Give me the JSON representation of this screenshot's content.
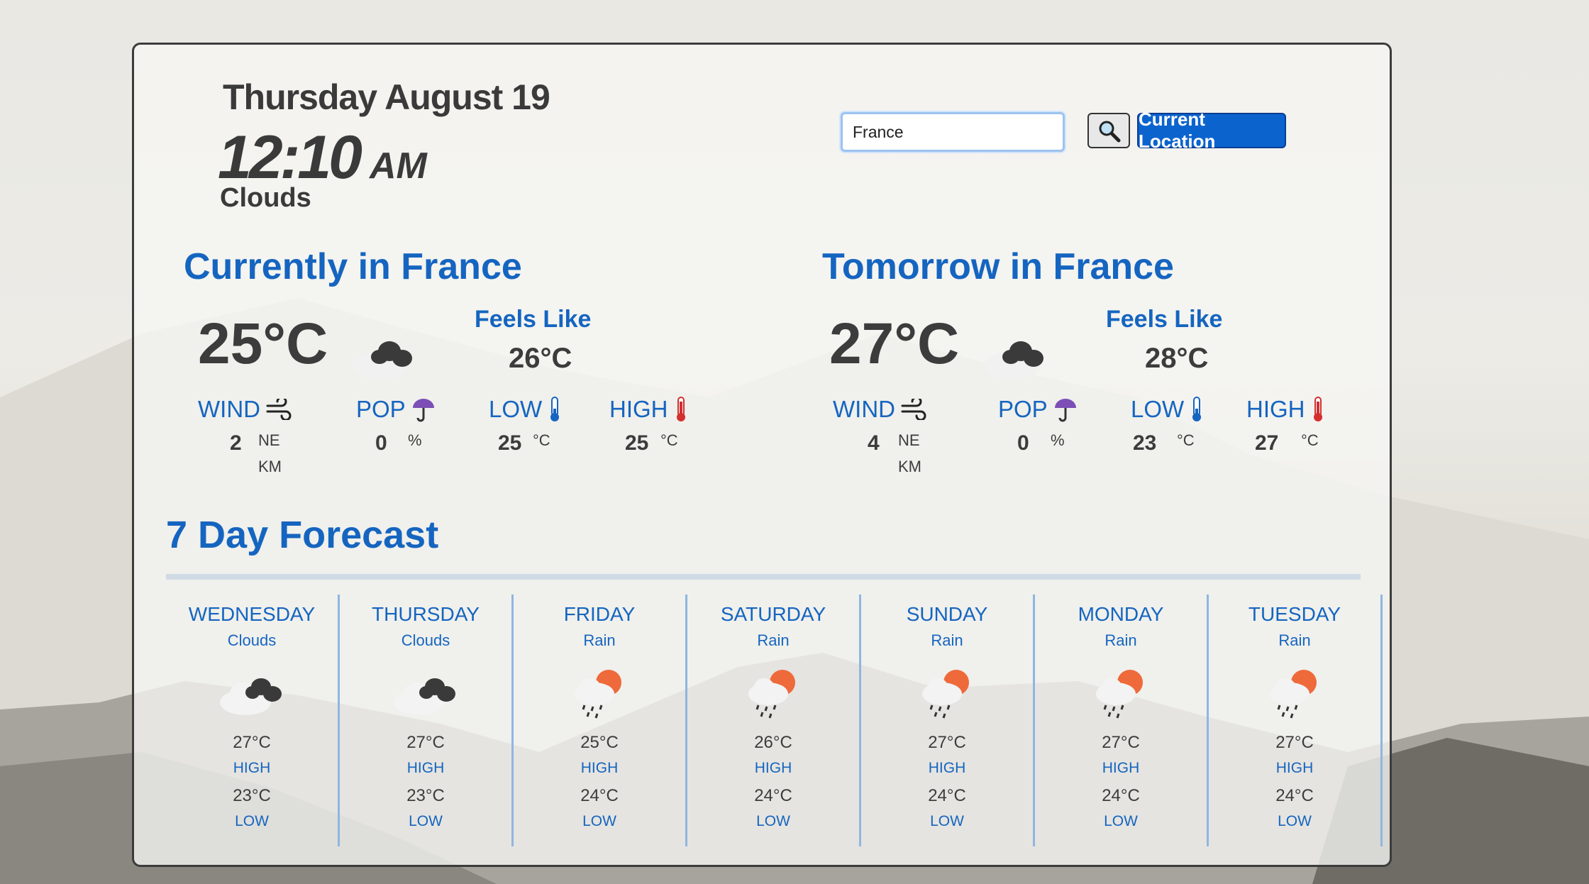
{
  "header": {
    "date": "Thursday August 19",
    "time": "12:10",
    "ampm": "AM",
    "condition": "Clouds"
  },
  "search": {
    "value": "France",
    "search_icon": "magnifier-icon",
    "location_button": "Current Location"
  },
  "current": {
    "heading": "Currently in France",
    "temp": "25°C",
    "icon": "dark-clouds-icon",
    "feels_label": "Feels Like",
    "feels_value": "26°C",
    "wind_label": "WIND",
    "wind_value": "2",
    "wind_dir": "NE",
    "wind_unit": "KM",
    "pop_label": "POP",
    "pop_value": "0",
    "pop_unit": "%",
    "low_label": "LOW",
    "low_value": "25",
    "low_unit": "°C",
    "high_label": "HIGH",
    "high_value": "25",
    "high_unit": "°C"
  },
  "tomorrow": {
    "heading": "Tomorrow in France",
    "temp": "27°C",
    "icon": "dark-clouds-icon",
    "feels_label": "Feels Like",
    "feels_value": "28°C",
    "wind_label": "WIND",
    "wind_value": "4",
    "wind_dir": "NE",
    "wind_unit": "KM",
    "pop_label": "POP",
    "pop_value": "0",
    "pop_unit": "%",
    "low_label": "LOW",
    "low_value": "23",
    "low_unit": "°C",
    "high_label": "HIGH",
    "high_value": "27",
    "high_unit": "°C"
  },
  "forecast": {
    "title": "7 Day Forecast",
    "days": [
      {
        "name": "WEDNESDAY",
        "cond": "Clouds",
        "icon": "clouds-icon",
        "high": "27°C",
        "high_label": "HIGH",
        "low": "23°C",
        "low_label": "LOW"
      },
      {
        "name": "THURSDAY",
        "cond": "Clouds",
        "icon": "clouds-icon",
        "high": "27°C",
        "high_label": "HIGH",
        "low": "23°C",
        "low_label": "LOW"
      },
      {
        "name": "FRIDAY",
        "cond": "Rain",
        "icon": "rain-sun-icon",
        "high": "25°C",
        "high_label": "HIGH",
        "low": "24°C",
        "low_label": "LOW"
      },
      {
        "name": "SATURDAY",
        "cond": "Rain",
        "icon": "rain-sun-icon",
        "high": "26°C",
        "high_label": "HIGH",
        "low": "24°C",
        "low_label": "LOW"
      },
      {
        "name": "SUNDAY",
        "cond": "Rain",
        "icon": "rain-sun-icon",
        "high": "27°C",
        "high_label": "HIGH",
        "low": "24°C",
        "low_label": "LOW"
      },
      {
        "name": "MONDAY",
        "cond": "Rain",
        "icon": "rain-sun-icon",
        "high": "27°C",
        "high_label": "HIGH",
        "low": "24°C",
        "low_label": "LOW"
      },
      {
        "name": "TUESDAY",
        "cond": "Rain",
        "icon": "rain-sun-icon",
        "high": "27°C",
        "high_label": "HIGH",
        "low": "24°C",
        "low_label": "LOW"
      }
    ]
  }
}
